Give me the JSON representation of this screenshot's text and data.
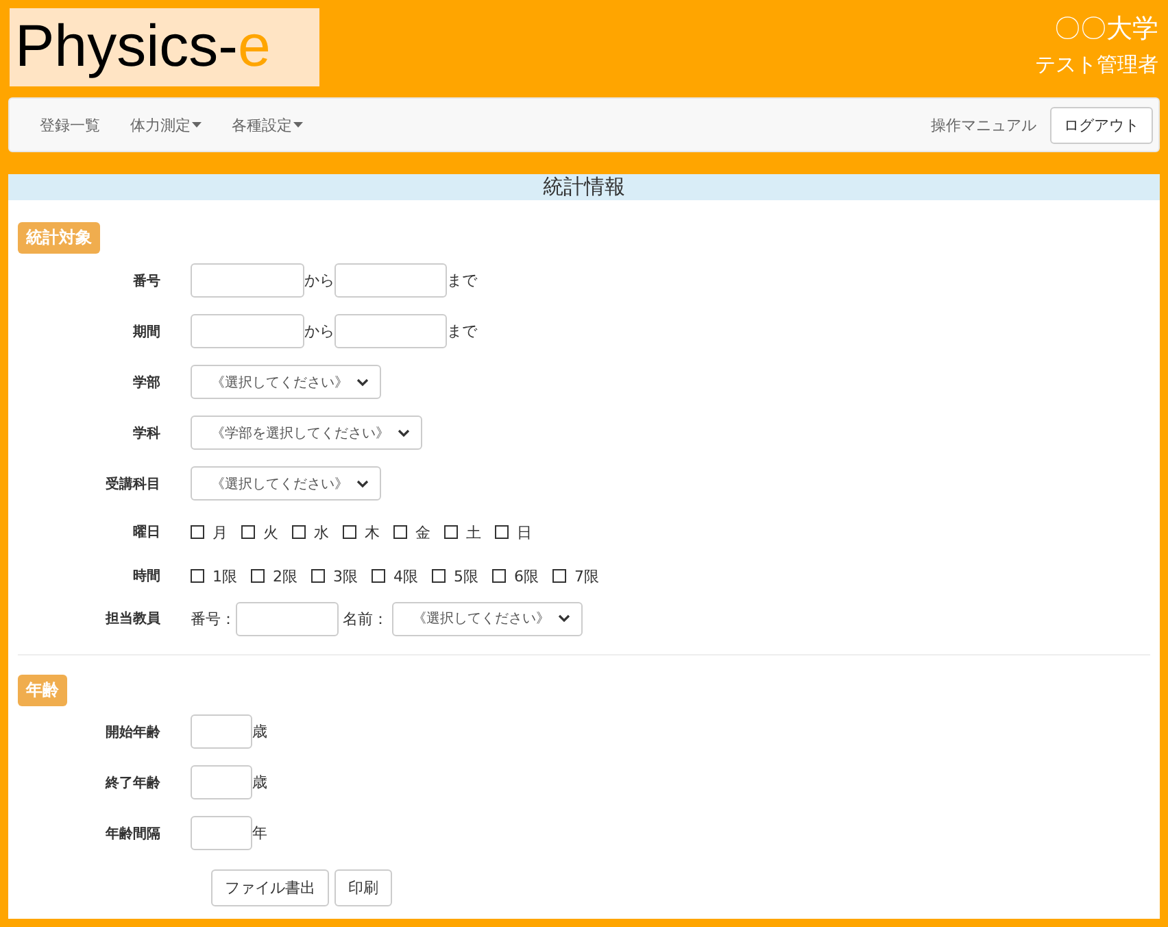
{
  "header": {
    "logo_main": "Physics-",
    "logo_accent": "e",
    "university": "〇〇大学",
    "user": "テスト管理者"
  },
  "nav": {
    "items": [
      {
        "label": "登録一覧",
        "dropdown": false
      },
      {
        "label": "体力測定",
        "dropdown": true
      },
      {
        "label": "各種設定",
        "dropdown": true
      }
    ],
    "manual": "操作マニュアル",
    "logout": "ログアウト"
  },
  "panel": {
    "title": "統計情報",
    "sections": [
      {
        "label": "統計対象",
        "rows": [
          {
            "kind": "range",
            "label": "番号",
            "from": "から",
            "to": "まで"
          },
          {
            "kind": "range",
            "label": "期間",
            "from": "から",
            "to": "まで"
          },
          {
            "kind": "select",
            "label": "学部",
            "value": "《選択してください》"
          },
          {
            "kind": "select",
            "label": "学科",
            "value": "《学部を選択してください》"
          },
          {
            "kind": "select",
            "label": "受講科目",
            "value": "《選択してください》"
          },
          {
            "kind": "checks",
            "label": "曜日",
            "options": [
              {
                "label": "月",
                "checked": false
              },
              {
                "label": "火",
                "checked": false
              },
              {
                "label": "水",
                "checked": false
              },
              {
                "label": "木",
                "checked": false
              },
              {
                "label": "金",
                "checked": false
              },
              {
                "label": "土",
                "checked": false
              },
              {
                "label": "日",
                "checked": false
              }
            ]
          },
          {
            "kind": "checks",
            "label": "時間",
            "options": [
              {
                "label": "1限",
                "checked": false
              },
              {
                "label": "2限",
                "checked": false
              },
              {
                "label": "3限",
                "checked": false
              },
              {
                "label": "4限",
                "checked": false
              },
              {
                "label": "5限",
                "checked": false
              },
              {
                "label": "6限",
                "checked": false
              },
              {
                "label": "7限",
                "checked": false
              }
            ]
          },
          {
            "kind": "teacher",
            "label": "担当教員",
            "number_label": "番号：",
            "name_label": "名前：",
            "value": "《選択してください》"
          }
        ]
      },
      {
        "label": "年齢",
        "rows": [
          {
            "kind": "unit",
            "label": "開始年齢",
            "unit": "歳"
          },
          {
            "kind": "unit",
            "label": "終了年齢",
            "unit": "歳"
          },
          {
            "kind": "unit",
            "label": "年齢間隔",
            "unit": "年"
          }
        ]
      }
    ],
    "buttons": [
      "ファイル書出",
      "印刷"
    ]
  }
}
